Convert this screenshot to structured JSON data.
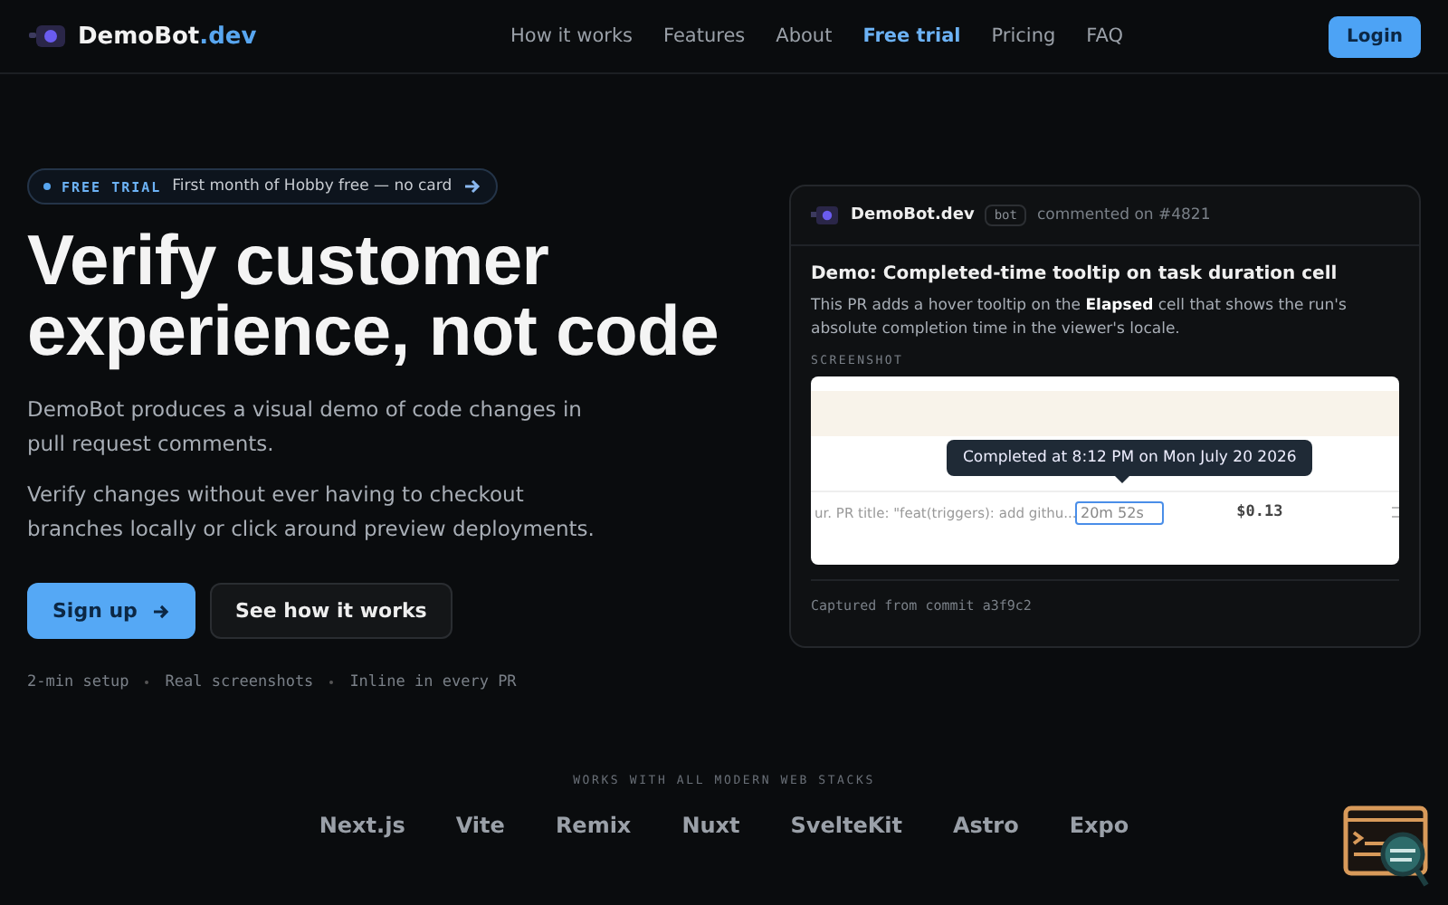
{
  "header": {
    "logo": {
      "name": "DemoBot",
      "tld": ".dev"
    },
    "nav": [
      {
        "label": "How it works",
        "selected": false
      },
      {
        "label": "Features",
        "selected": false
      },
      {
        "label": "About",
        "selected": false
      },
      {
        "label": "Free trial",
        "selected": true
      },
      {
        "label": "Pricing",
        "selected": false
      },
      {
        "label": "FAQ",
        "selected": false
      }
    ],
    "login": "Login"
  },
  "badge": {
    "tag": "FREE TRIAL",
    "text": "First month of Hobby free — no card"
  },
  "hero": {
    "title": "Verify customer experience, not code",
    "paragraphs": [
      "DemoBot produces a visual demo of code changes in pull request comments.",
      "Verify changes without ever having to checkout branches locally or click around preview deployments."
    ],
    "primary": "Sign up",
    "secondary": "See how it works",
    "meta": [
      "2-min setup",
      "Real screenshots",
      "Inline in every PR"
    ]
  },
  "card": {
    "author": "DemoBot.dev",
    "tag": "bot",
    "action": "commented on #4821",
    "title": "Demo: Completed-time tooltip on task duration cell",
    "body": "This PR adds a hover tooltip on the **Elapsed** cell that shows the run's absolute completion time in the viewer's locale.",
    "section": "SCREENSHOT",
    "screenshot": {
      "tooltip": "Completed at 8:12 PM on Mon July 20 2026",
      "row_text": "ur. PR title: \"feat(triggers): add githu...",
      "cell": "20m 52s",
      "cost": "$0.13"
    },
    "footer": "Captured from commit a3f9c2"
  },
  "stacks": {
    "label": "WORKS WITH ALL MODERN WEB STACKS",
    "items": [
      "Next.js",
      "Vite",
      "Remix",
      "Nuxt",
      "SvelteKit",
      "Astro",
      "Expo"
    ]
  }
}
